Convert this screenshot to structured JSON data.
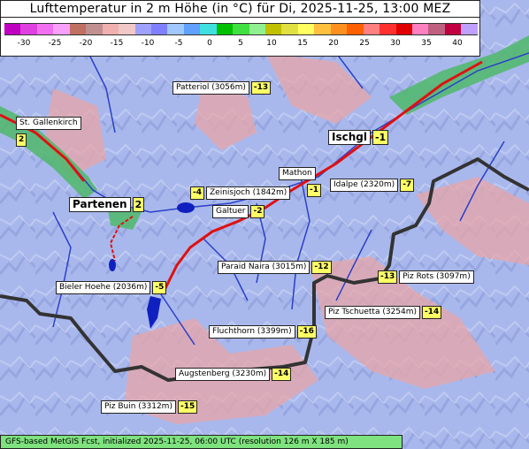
{
  "title": "Lufttemperatur in 2 m Höhe (in °C) für Di, 2025-11-25, 13:00 MEZ",
  "legend": {
    "ticks": [
      "-30",
      "-25",
      "-20",
      "-15",
      "-10",
      "-5",
      "0",
      "5",
      "10",
      "15",
      "20",
      "25",
      "30",
      "35",
      "40"
    ],
    "colors": [
      "#c000c0",
      "#e040e0",
      "#f070f0",
      "#f8a0f8",
      "#c07060",
      "#c09090",
      "#f0b0b0",
      "#f0c8c8",
      "#a0a0ff",
      "#8080ff",
      "#a0c8ff",
      "#60a0ff",
      "#40e0e0",
      "#00c000",
      "#40e040",
      "#90f090",
      "#c0c000",
      "#e0e040",
      "#ffff60",
      "#ffc040",
      "#ff9020",
      "#ff6000",
      "#ff8080",
      "#ff3030",
      "#e00000",
      "#ff80c0",
      "#c06080",
      "#c00040",
      "#c0a0ff"
    ]
  },
  "labels": [
    {
      "name": "Patteriol (3056m)",
      "value": "-13"
    },
    {
      "name": "St. Gallenkirch",
      "value": "2"
    },
    {
      "name": "Ischgl",
      "value": "-1"
    },
    {
      "name": "Mathon",
      "value": "-1"
    },
    {
      "name": "Idalpe (2320m)",
      "value": "-7"
    },
    {
      "name": "Zeinisjoch (1842m)",
      "value": "-4"
    },
    {
      "name": "Partenen",
      "value": "2"
    },
    {
      "name": "Galtuer",
      "value": "-2"
    },
    {
      "name": "Paraid Naira (3015m)",
      "value": "-12"
    },
    {
      "name": "Piz Rots (3097m)",
      "value": "-13"
    },
    {
      "name": "Bieler Hoehe (2036m)",
      "value": "-5"
    },
    {
      "name": "Piz Tschuetta (3254m)",
      "value": "-14"
    },
    {
      "name": "Fluchthorn (3399m)",
      "value": "-16"
    },
    {
      "name": "Augstenberg (3230m)",
      "value": "-14"
    },
    {
      "name": "Piz Buin (3312m)",
      "value": "-15"
    }
  ],
  "footer": "GFS-based MetGIS Fcst, initialized 2025-11-25, 06:00 UTC  (resolution 126 m X 185 m)"
}
